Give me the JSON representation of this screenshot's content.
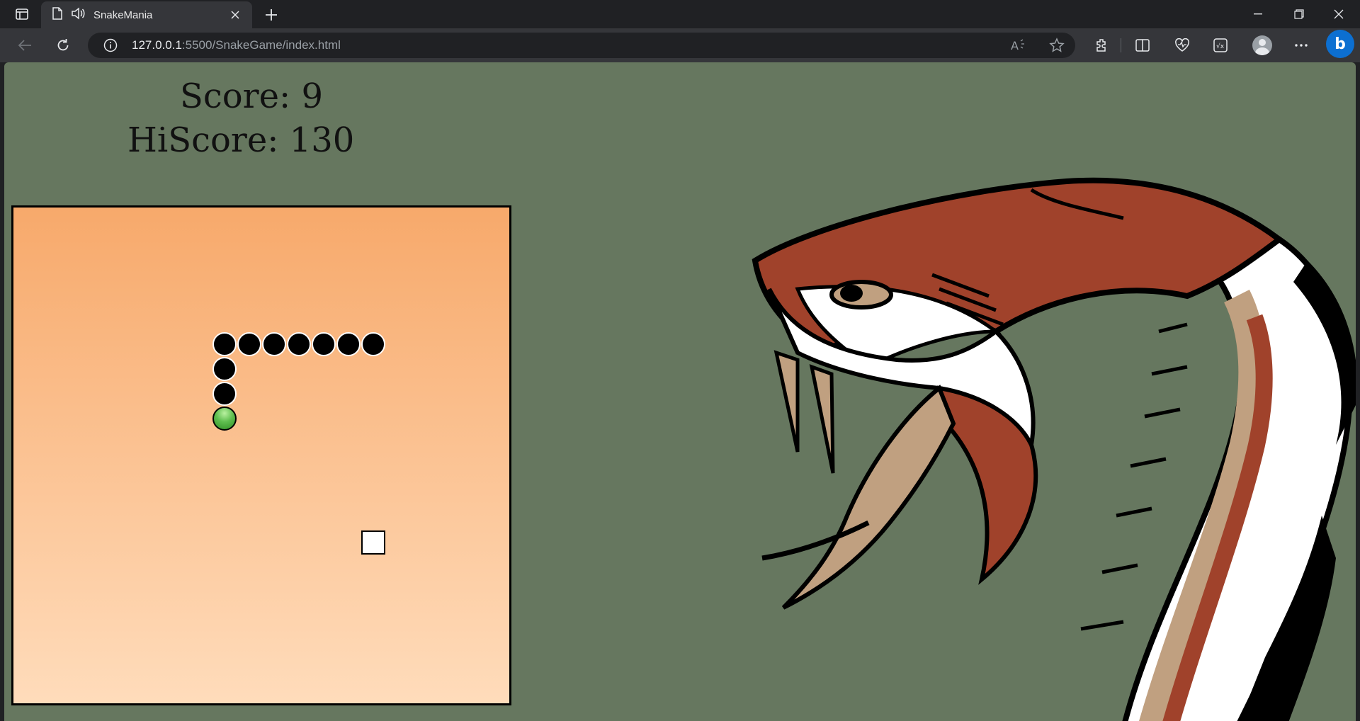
{
  "browser": {
    "tab_title": "SnakeMania",
    "url_host": "127.0.0.1",
    "url_rest": ":5500/SnakeGame/index.html"
  },
  "game": {
    "score_text": "Score: 9",
    "hiscore_text": "HiScore: 130",
    "score": 9,
    "hiscore": 130,
    "grid_size": 20,
    "snake_head": {
      "col": 9,
      "row": 9
    },
    "snake_body": [
      {
        "col": 9,
        "row": 8
      },
      {
        "col": 9,
        "row": 7
      },
      {
        "col": 9,
        "row": 6
      },
      {
        "col": 10,
        "row": 6
      },
      {
        "col": 11,
        "row": 6
      },
      {
        "col": 12,
        "row": 6
      },
      {
        "col": 13,
        "row": 6
      },
      {
        "col": 14,
        "row": 6
      },
      {
        "col": 15,
        "row": 6
      }
    ],
    "food": {
      "col": 15,
      "row": 14
    }
  },
  "colors": {
    "page_background": "#66775f",
    "board_top": "#f7a96b",
    "board_bottom": "#ffdcbb",
    "snake_body": "#000000",
    "snake_head": "#4caf50",
    "food": "#ffffff"
  },
  "icons": {
    "decorative_art": "snake-head-illustration"
  }
}
